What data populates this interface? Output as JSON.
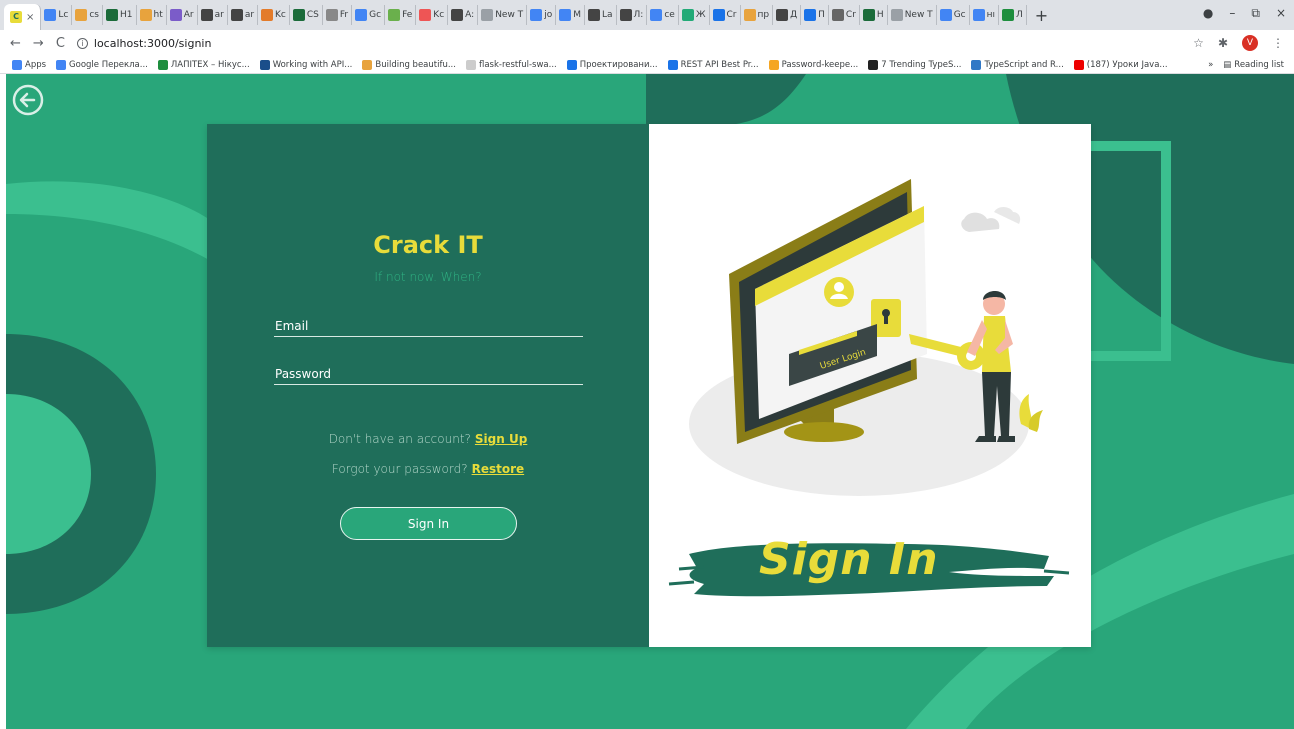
{
  "browser": {
    "active_tab_close": "×",
    "tabs": [
      {
        "label": "Lc",
        "color": "#4285f4"
      },
      {
        "label": "cs",
        "color": "#e8a33d"
      },
      {
        "label": "H1",
        "color": "#1b6b3a"
      },
      {
        "label": "ht",
        "color": "#e8a33d"
      },
      {
        "label": "Ar",
        "color": "#7b5cc9"
      },
      {
        "label": "ar",
        "color": "#444"
      },
      {
        "label": "ar",
        "color": "#444"
      },
      {
        "label": "Kc",
        "color": "#e37b2a"
      },
      {
        "label": "CS",
        "color": "#1b6b3a"
      },
      {
        "label": "Fr",
        "color": "#888"
      },
      {
        "label": "Gc",
        "color": "#4285f4"
      },
      {
        "label": "Fe",
        "color": "#6ab04c"
      },
      {
        "label": "Kc",
        "color": "#e55"
      },
      {
        "label": "A:",
        "color": "#444"
      },
      {
        "label": "New T",
        "color": "#9aa0a6"
      },
      {
        "label": "jo",
        "color": "#4285f4"
      },
      {
        "label": "M",
        "color": "#4285f4"
      },
      {
        "label": "La",
        "color": "#444"
      },
      {
        "label": "Л:",
        "color": "#444"
      },
      {
        "label": "ce",
        "color": "#4285f4"
      },
      {
        "label": "Ж",
        "color": "#2a7"
      },
      {
        "label": "Cr",
        "color": "#1a73e8"
      },
      {
        "label": "пр",
        "color": "#e8a33d"
      },
      {
        "label": "Д",
        "color": "#444"
      },
      {
        "label": "П",
        "color": "#1a73e8"
      },
      {
        "label": "Cr",
        "color": "#666"
      },
      {
        "label": "H",
        "color": "#1b6b3a"
      },
      {
        "label": "New T",
        "color": "#9aa0a6"
      },
      {
        "label": "Gc",
        "color": "#4285f4"
      },
      {
        "label": "нı",
        "color": "#4285f4"
      },
      {
        "label": "Л",
        "color": "#1e8e3e"
      }
    ],
    "new_tab": "+",
    "window_controls": [
      "●",
      "–",
      "⧉",
      "×"
    ],
    "url": "localhost:3000/signin",
    "bookmarks": [
      {
        "label": "Apps",
        "color": "#4285f4"
      },
      {
        "label": "Google Перекла...",
        "color": "#4285f4"
      },
      {
        "label": "ЛАПІТЕХ – Нікус...",
        "color": "#1e8e3e"
      },
      {
        "label": "Working with API...",
        "color": "#1a4e8a"
      },
      {
        "label": "Building beautifu...",
        "color": "#e8a33d"
      },
      {
        "label": "flask-restful-swa...",
        "color": "#ccc"
      },
      {
        "label": "Проектировани...",
        "color": "#1a73e8"
      },
      {
        "label": "REST API Best Pr...",
        "color": "#1a73e8"
      },
      {
        "label": "Password-keepe...",
        "color": "#f5a623"
      },
      {
        "label": "7 Trending TypeS...",
        "color": "#222"
      },
      {
        "label": "TypeScript and R...",
        "color": "#3178c6"
      },
      {
        "label": "(187) Уроки Java...",
        "color": "#e00"
      }
    ],
    "bookmarks_more": "»",
    "reading_list": "Reading list",
    "profile_initial": "V"
  },
  "signin": {
    "title": "Crack IT",
    "subtitle": "If not now. When?",
    "email_placeholder": "Email",
    "password_placeholder": "Password",
    "no_account_text": "Don't have an account?",
    "signup_link": "Sign Up",
    "forgot_text": "Forgot your password?",
    "restore_link": "Restore",
    "button_label": "Sign In"
  },
  "illustration": {
    "screen_label": "User Login",
    "banner_text": "Sign In"
  },
  "colors": {
    "page_bg": "#29a67a",
    "panel_bg": "#1f6e5a",
    "accent_yellow": "#e8dc3a",
    "dark_shape": "#1f6e5a"
  }
}
